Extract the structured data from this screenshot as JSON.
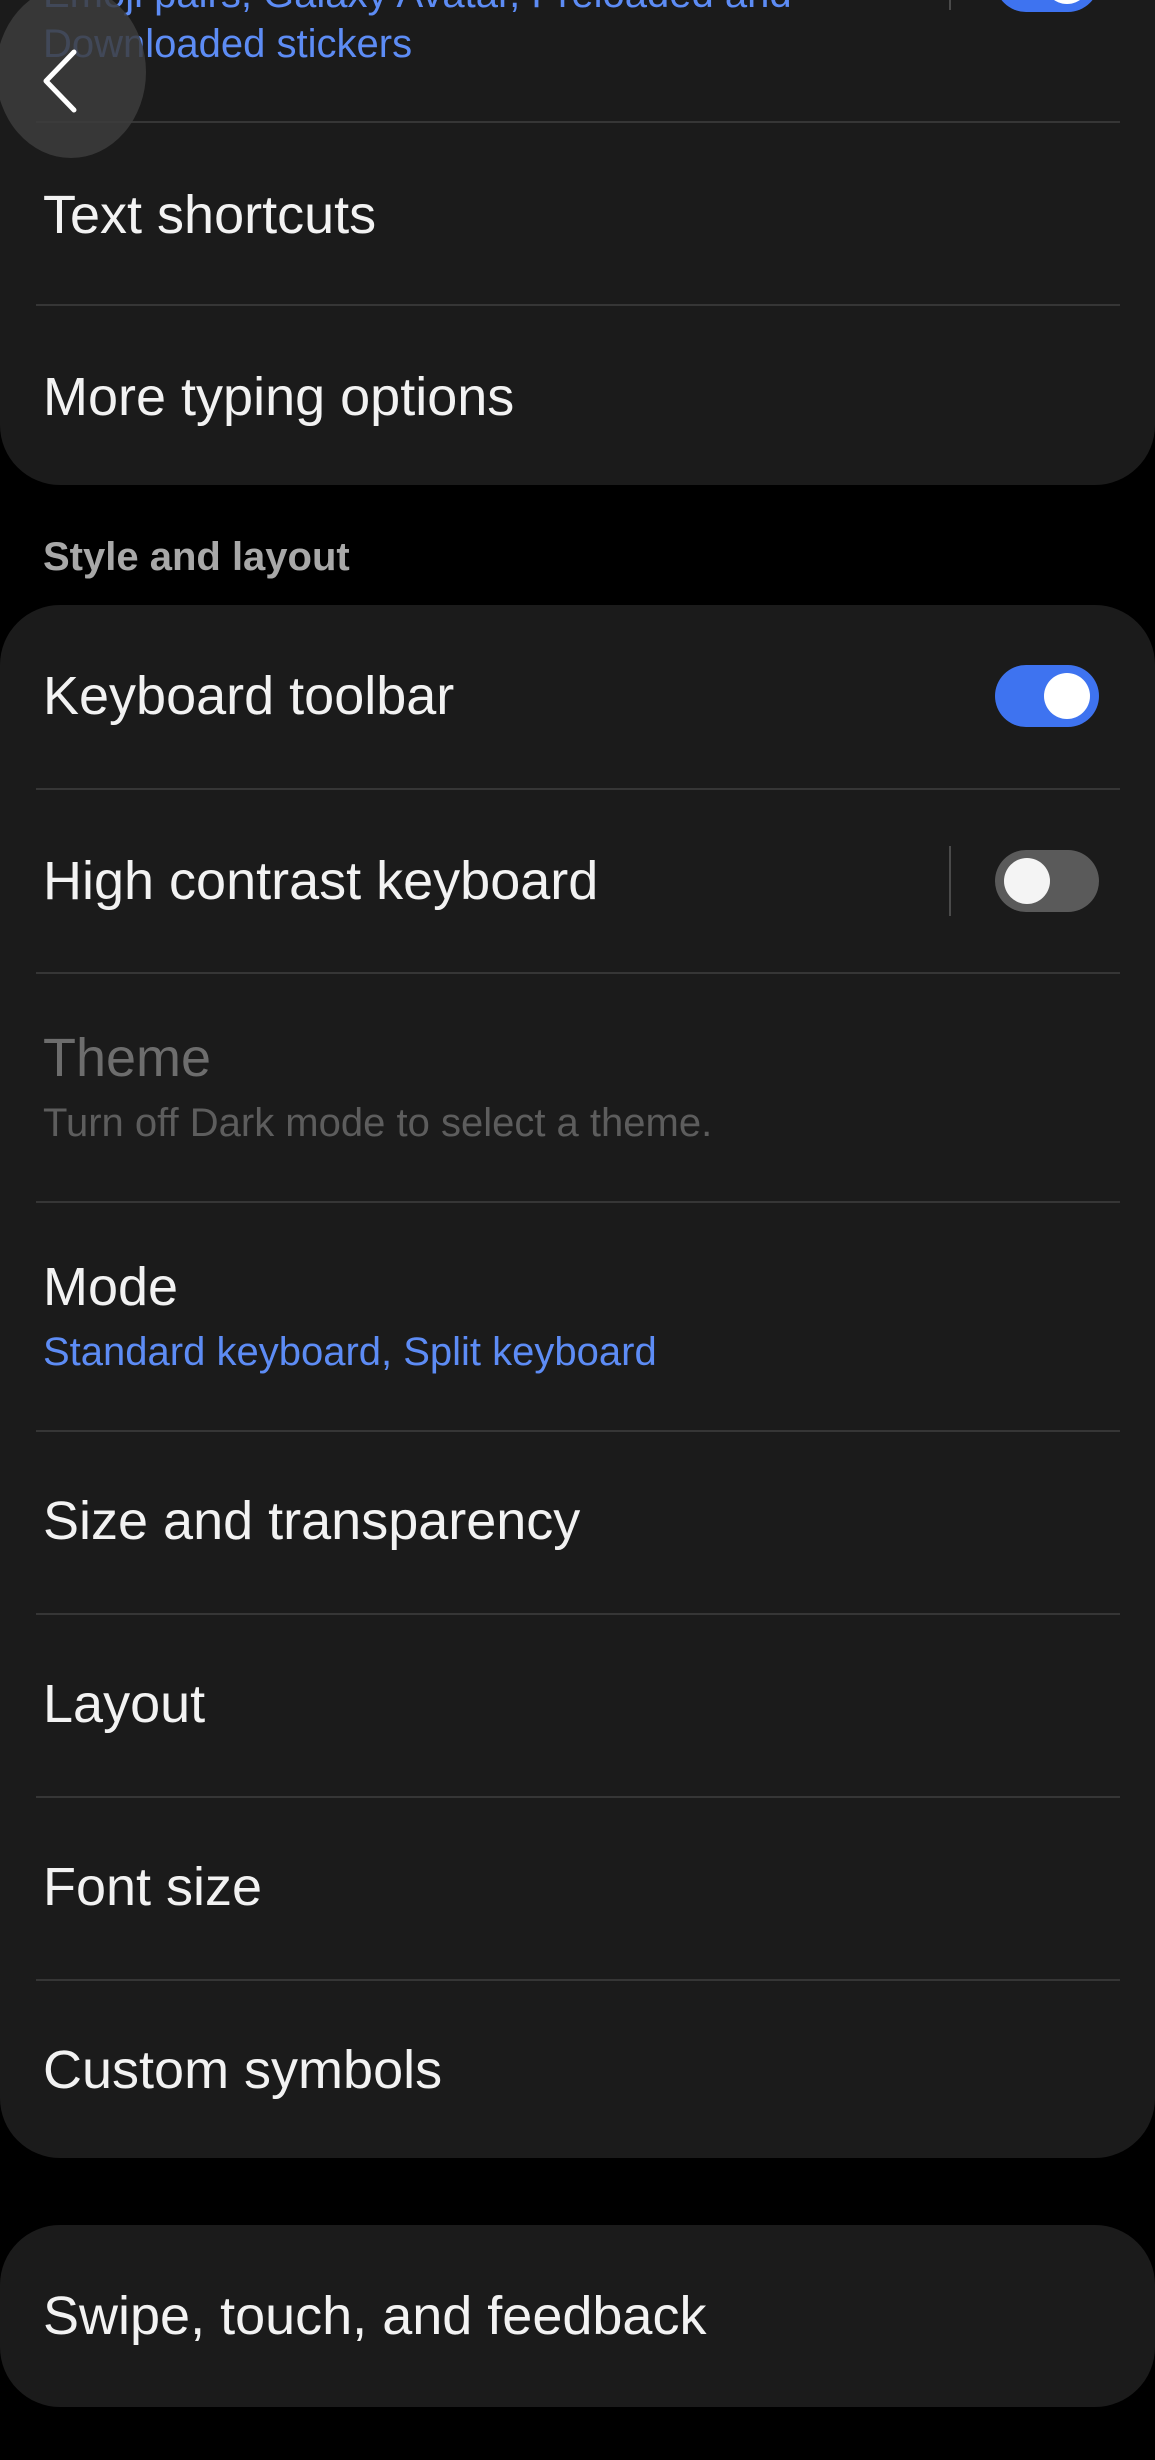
{
  "top_card": {
    "stickers_line1": "Emoji pairs, Galaxy Avatar, Preloaded and",
    "stickers_line2": "Downloaded stickers",
    "text_shortcuts": "Text shortcuts",
    "more_typing_options": "More typing options"
  },
  "style_section": {
    "header": "Style and layout",
    "keyboard_toolbar": {
      "label": "Keyboard toolbar",
      "enabled": true
    },
    "high_contrast": {
      "label": "High contrast keyboard",
      "enabled": false
    },
    "theme": {
      "label": "Theme",
      "summary": "Turn off Dark mode to select a theme."
    },
    "mode": {
      "label": "Mode",
      "summary": "Standard keyboard, Split keyboard"
    },
    "size_transparency": "Size and transparency",
    "layout": "Layout",
    "font_size": "Font size",
    "custom_symbols": "Custom symbols"
  },
  "swipe_card": {
    "label": "Swipe, touch, and feedback"
  },
  "icons": {
    "back": "back-arrow-icon"
  },
  "colors": {
    "accent": "#3e73f0",
    "summary_blue": "#5d8cf5",
    "card_bg": "#1b1b1b",
    "page_bg": "#000000"
  }
}
